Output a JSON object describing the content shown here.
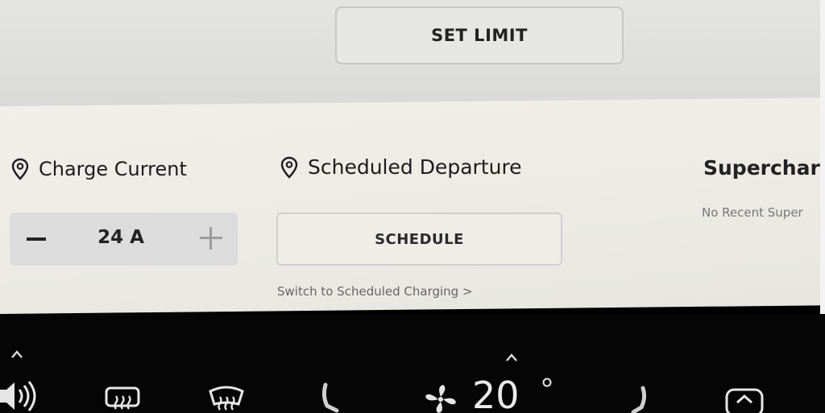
{
  "top": {
    "set_limit_label": "SET LIMIT"
  },
  "charge_current": {
    "title": "Charge Current",
    "value": "24 A",
    "icon": "location-pin-icon"
  },
  "scheduled_departure": {
    "title": "Scheduled Departure",
    "button_label": "SCHEDULE",
    "switch_link": "Switch to Scheduled Charging >",
    "icon": "location-pin-icon"
  },
  "supercharging": {
    "title": "Superchar",
    "status": "No Recent Super"
  },
  "climate_bar": {
    "temperature": "20",
    "icons": [
      "chevron-up-icon",
      "volume-icon",
      "rear-defrost-icon",
      "front-defrost-icon",
      "seat-heater-left-icon",
      "fan-icon",
      "degree-icon",
      "seat-heater-right-icon",
      "vent-icon"
    ]
  },
  "colors": {
    "background_light": "#ecebe6",
    "top_panel": "#dededc",
    "bottom_bar": "#050505",
    "text_dark": "#1c1c1c",
    "text_muted": "#666666"
  }
}
